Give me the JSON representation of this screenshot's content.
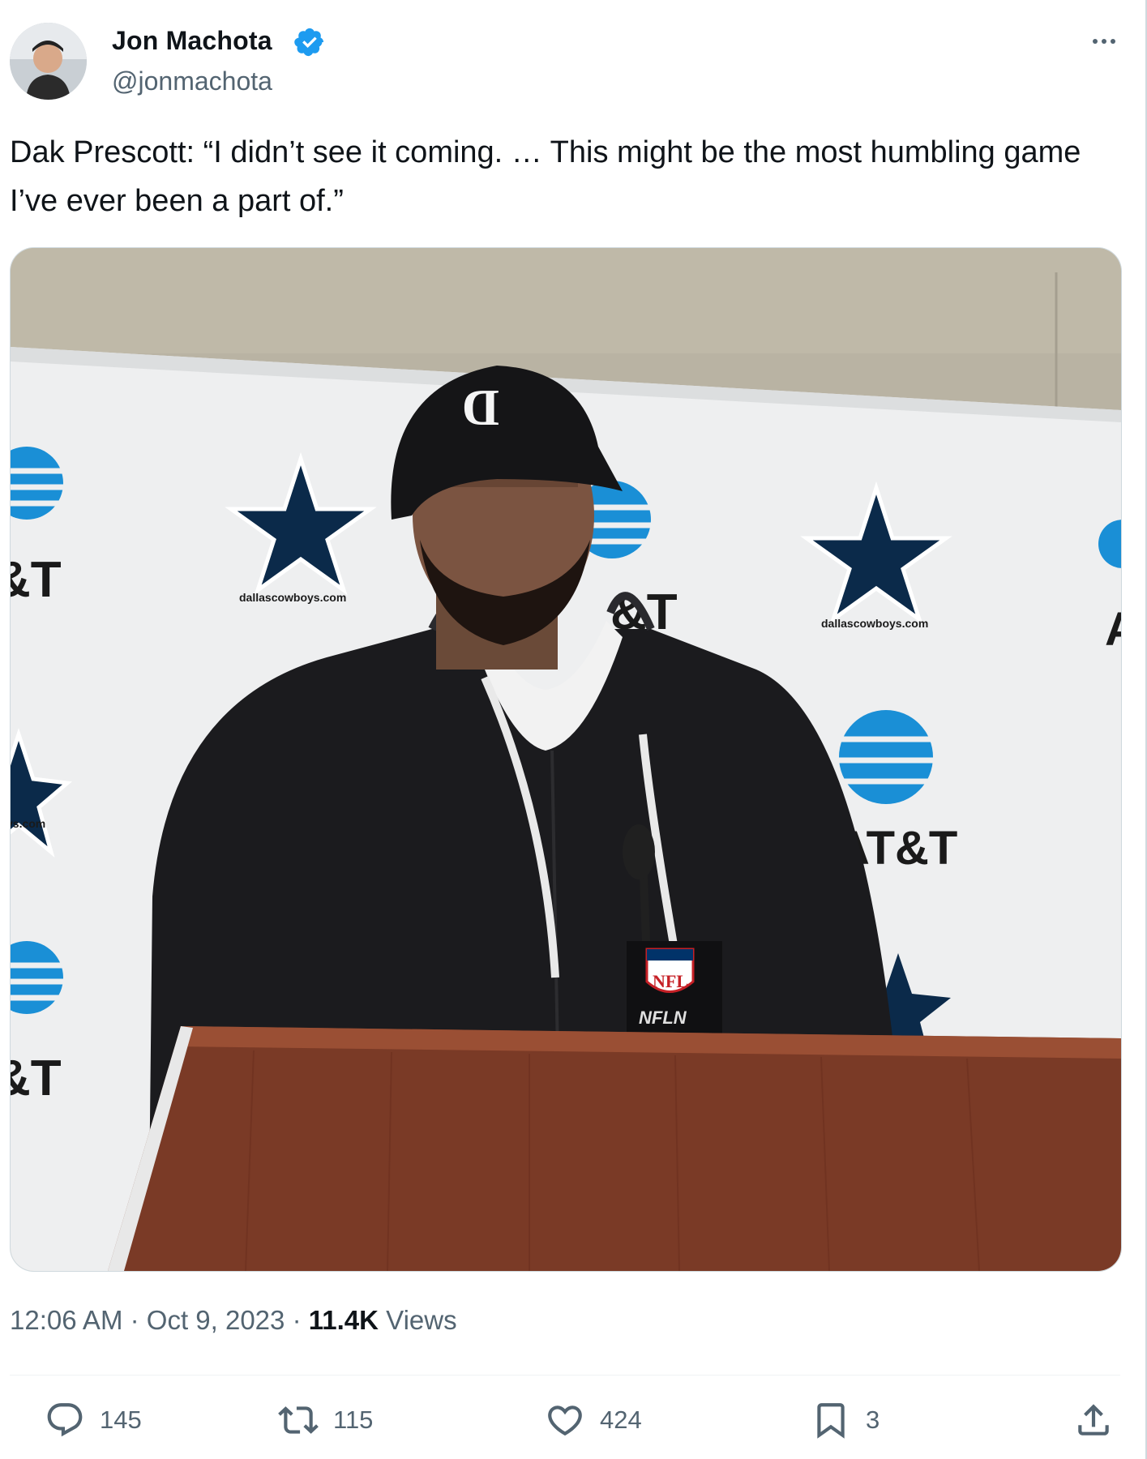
{
  "author": {
    "name": "Jon Machota",
    "handle": "@jonmachota",
    "verified": true
  },
  "tweet": {
    "text": "Dak Prescott: “I didn’t see it coming. … This might be the most humbling game I’ve ever been a part of.”"
  },
  "media": {
    "backdrop_logos": [
      "AT&T",
      "dallascowboys.com"
    ],
    "mic_flag": "NFL",
    "mic_label": "NFLN",
    "cap_letter": "D"
  },
  "meta": {
    "time": "12:06 AM",
    "separator": "·",
    "date": "Oct 9, 2023",
    "views_count": "11.4K",
    "views_label": "Views"
  },
  "actions": {
    "replies": "145",
    "reposts": "115",
    "likes": "424",
    "bookmarks": "3"
  },
  "colors": {
    "text": "#0f1419",
    "secondary": "#536471",
    "verified": "#1d9bf0",
    "cowboys_blue": "#0b2a4a",
    "att_blue": "#1a8fd6",
    "podium": "#7a3a26"
  }
}
